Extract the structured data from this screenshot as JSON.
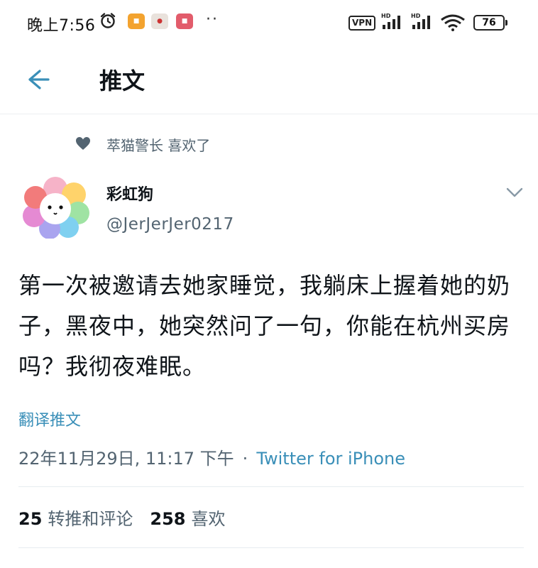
{
  "status_bar": {
    "time": "晚上7:56",
    "vpn": "VPN",
    "battery": "76",
    "apps": [
      "",
      "",
      ""
    ]
  },
  "header": {
    "title": "推文"
  },
  "liked_by": {
    "text": "萃猫警长 喜欢了"
  },
  "author": {
    "name": "彩虹狗",
    "handle": "@JerJerJer0217"
  },
  "tweet": {
    "text": "第一次被邀请去她家睡觉，我躺床上握着她的奶子，黑夜中，她突然问了一句，你能在杭州买房吗？我彻夜难眠。",
    "translate_label": "翻译推文",
    "timestamp": "22年11月29日, 11:17 下午",
    "separator": "·",
    "source": "Twitter for iPhone"
  },
  "stats": {
    "retweets_count": "25",
    "retweets_label": "转推和评论",
    "likes_count": "258",
    "likes_label": "喜欢"
  },
  "colors": {
    "accent": "#3a8fb8",
    "secondary_text": "#536471",
    "primary_text": "#0f1419"
  },
  "icons": [
    "alarm-icon",
    "vpn-badge",
    "signal-icon",
    "wifi-icon",
    "battery-icon",
    "back-arrow-icon",
    "heart-icon",
    "chevron-down-icon"
  ]
}
